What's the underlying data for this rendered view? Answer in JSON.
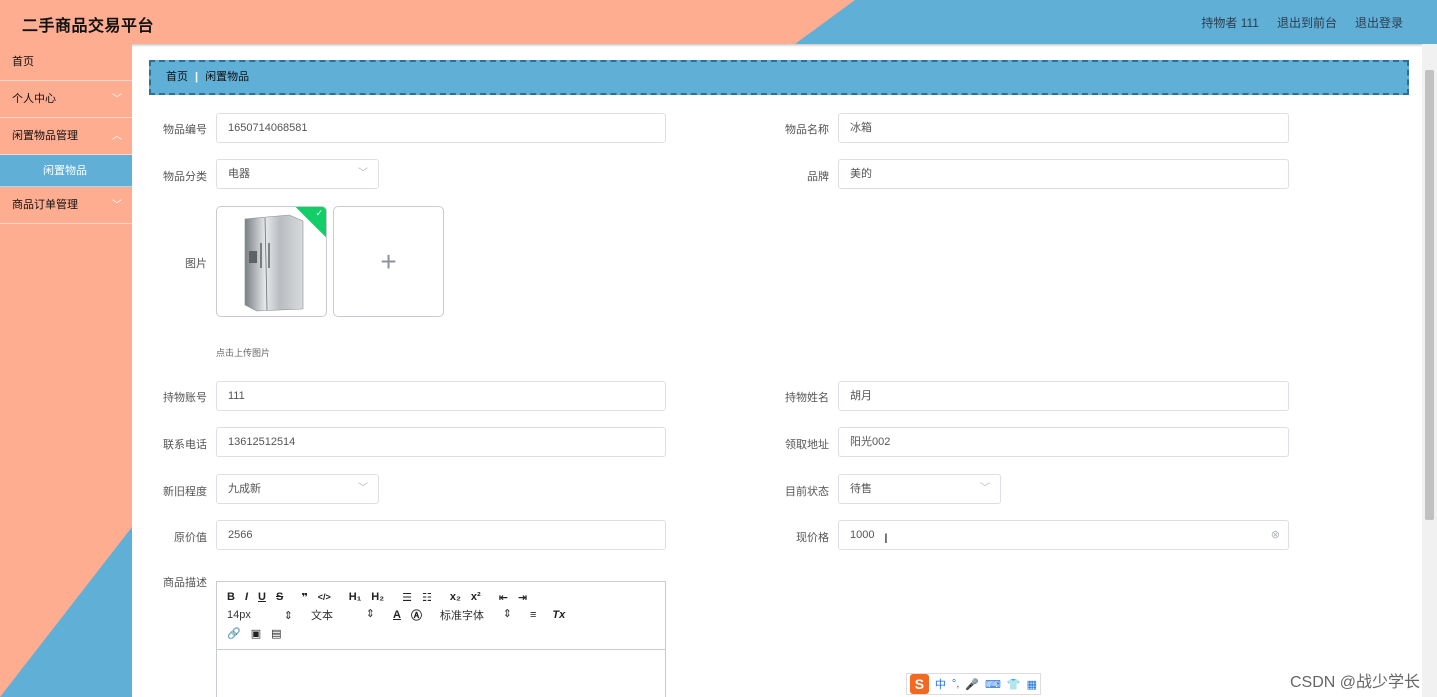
{
  "header": {
    "title": "二手商品交易平台",
    "user_label": "持物者 111",
    "front_label": "退出到前台",
    "logout_label": "退出登录"
  },
  "sidebar": {
    "items": [
      {
        "label": "首页"
      },
      {
        "label": "个人中心"
      },
      {
        "label": "闲置物品管理"
      },
      {
        "label": "闲置物品"
      },
      {
        "label": "商品订单管理"
      }
    ]
  },
  "breadcrumb": {
    "home": "首页",
    "separator": "|",
    "current": "闲置物品"
  },
  "form": {
    "item_no_label": "物品编号",
    "item_no_value": "1650714068581",
    "item_name_label": "物品名称",
    "item_name_value": "冰箱",
    "category_label": "物品分类",
    "category_value": "电器",
    "brand_label": "品牌",
    "brand_value": "美的",
    "image_label": "图片",
    "upload_hint": "点击上传图片",
    "holder_account_label": "持物账号",
    "holder_account_value": "111",
    "holder_name_label": "持物姓名",
    "holder_name_value": "胡月",
    "phone_label": "联系电话",
    "phone_value": "13612512514",
    "address_label": "领取地址",
    "address_value": "阳光002",
    "condition_label": "新旧程度",
    "condition_value": "九成新",
    "status_label": "目前状态",
    "status_value": "待售",
    "orig_price_label": "原价值",
    "orig_price_value": "2566",
    "price_label": "现价格",
    "price_value": "1000",
    "desc_label": "商品描述"
  },
  "editor": {
    "bold": "B",
    "italic": "I",
    "underline": "U",
    "strike": "S",
    "quote": "❞",
    "code": "</>",
    "h1": "H₁",
    "h2": "H₂",
    "ol": "☰",
    "ul": "☷",
    "sub": "x₂",
    "sup": "x²",
    "outdent": "⇤",
    "indent": "⇥",
    "font_size": "14px",
    "text_type": "文本",
    "font_family": "标准字体",
    "align": "≡",
    "clear": "Tx"
  },
  "ime": {
    "label": "中"
  },
  "watermark": "CSDN @战少学长",
  "colors": {
    "salmon": "#ffad91",
    "blue": "#5fafd6",
    "green": "#13ce66"
  }
}
